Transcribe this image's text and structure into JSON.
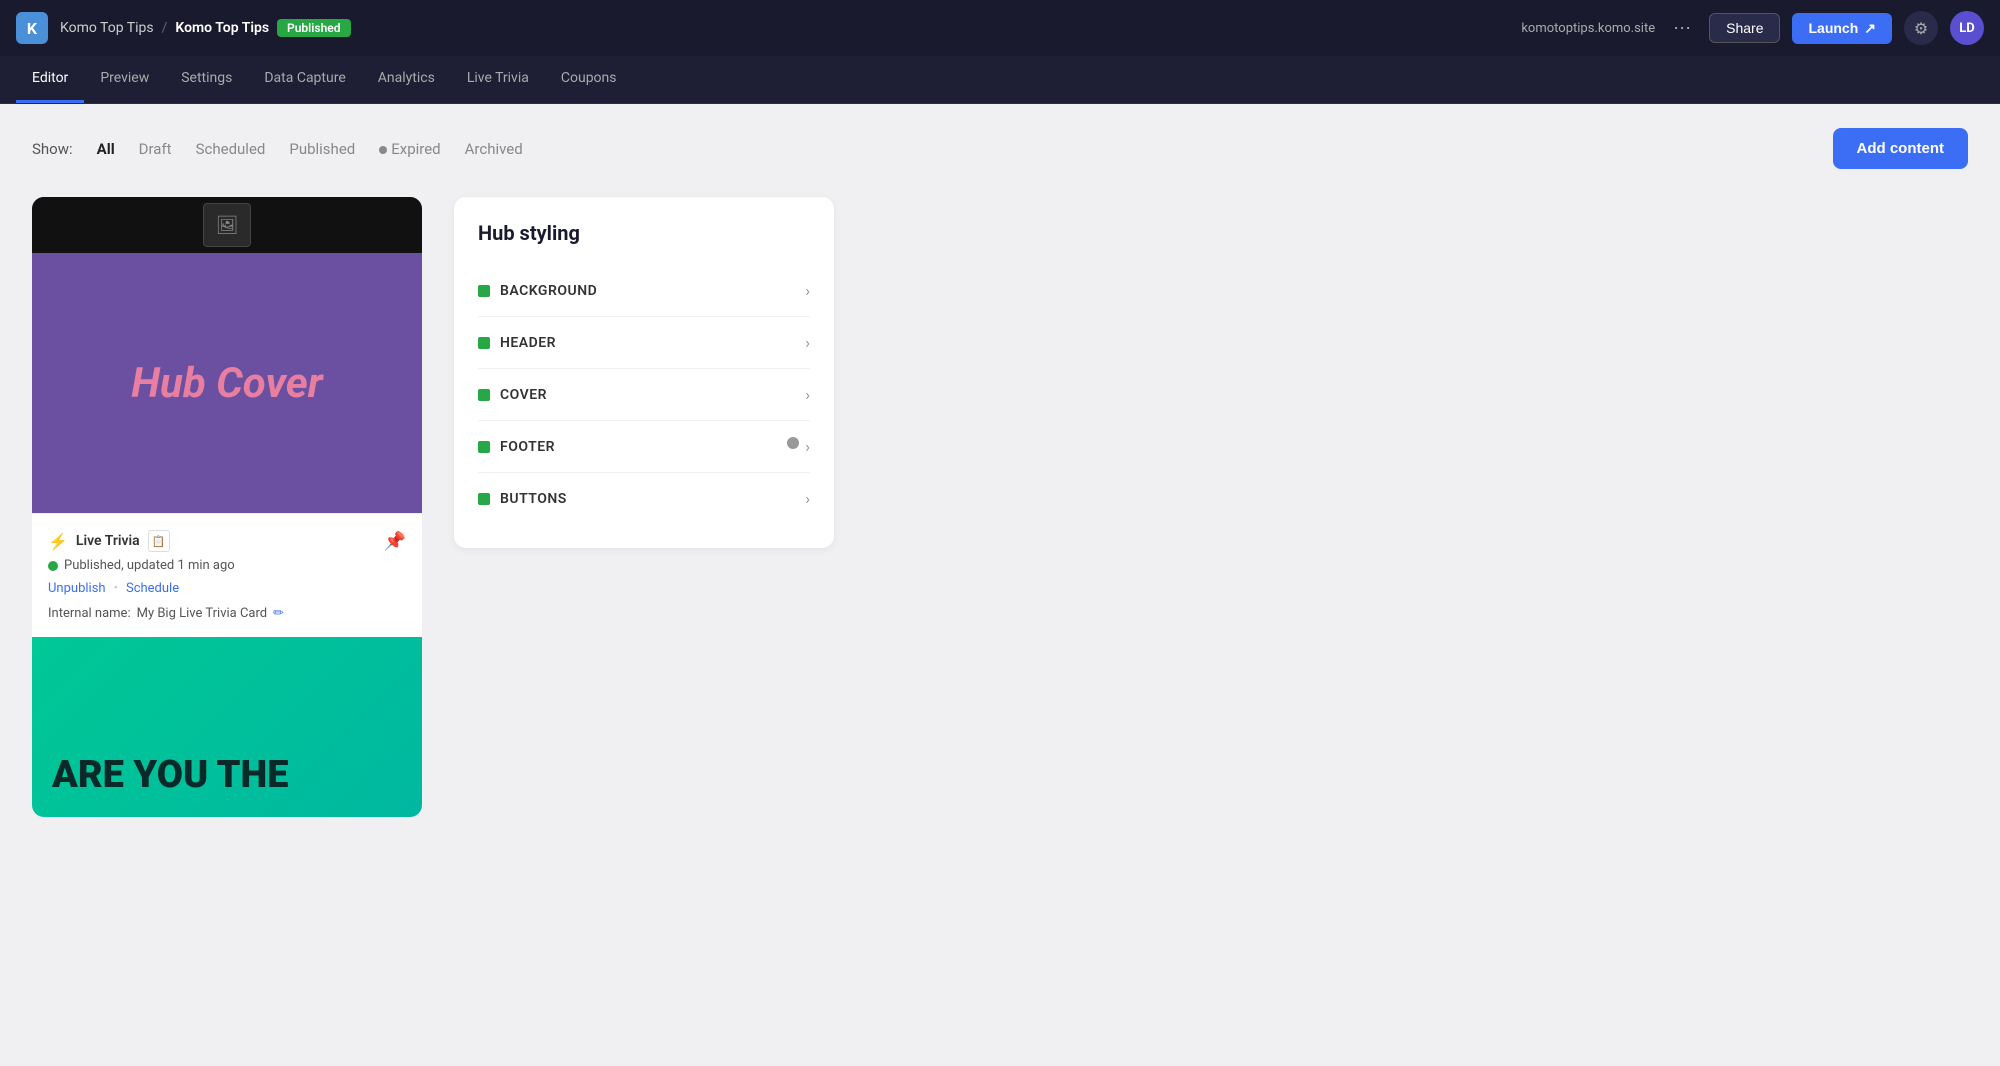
{
  "topbar": {
    "logo": "K",
    "breadcrumb_parent": "Komo Top Tips",
    "separator": "/",
    "breadcrumb_current": "Komo Top Tips",
    "published_badge": "Published",
    "site_url": "komotoptips.komo.site",
    "share_label": "Share",
    "launch_label": "Launch",
    "launch_icon": "↗",
    "settings_icon": "⚙",
    "avatar_initials": "LD"
  },
  "secondary_nav": {
    "items": [
      {
        "label": "Editor",
        "active": true
      },
      {
        "label": "Preview",
        "active": false
      },
      {
        "label": "Settings",
        "active": false
      },
      {
        "label": "Data Capture",
        "active": false
      },
      {
        "label": "Analytics",
        "active": false
      },
      {
        "label": "Live Trivia",
        "active": false
      },
      {
        "label": "Coupons",
        "active": false
      }
    ]
  },
  "filter_bar": {
    "show_label": "Show:",
    "filters": [
      {
        "label": "All",
        "active": true
      },
      {
        "label": "Draft",
        "active": false
      },
      {
        "label": "Scheduled",
        "active": false
      },
      {
        "label": "Published",
        "active": false
      },
      {
        "label": "Expired",
        "active": false,
        "has_dot": true
      },
      {
        "label": "Archived",
        "active": false
      }
    ],
    "add_content_label": "Add content"
  },
  "hub_cover": {
    "title_text": "Hub Cover",
    "icon_symbol": "🖼"
  },
  "content_item": {
    "type_label": "Live Trivia",
    "type_icon": "📋",
    "status_text": "Published, updated 1 min ago",
    "unpublish_label": "Unpublish",
    "schedule_label": "Schedule",
    "internal_name_prefix": "Internal name:",
    "internal_name": "My Big Live Trivia Card",
    "edit_icon": "✏"
  },
  "trivia_card": {
    "text": "ARE YOU THE"
  },
  "hub_styling": {
    "title": "Hub styling",
    "items": [
      {
        "label": "BACKGROUND"
      },
      {
        "label": "HEADER"
      },
      {
        "label": "COVER"
      },
      {
        "label": "FOOTER"
      },
      {
        "label": "BUTTONS"
      }
    ]
  }
}
